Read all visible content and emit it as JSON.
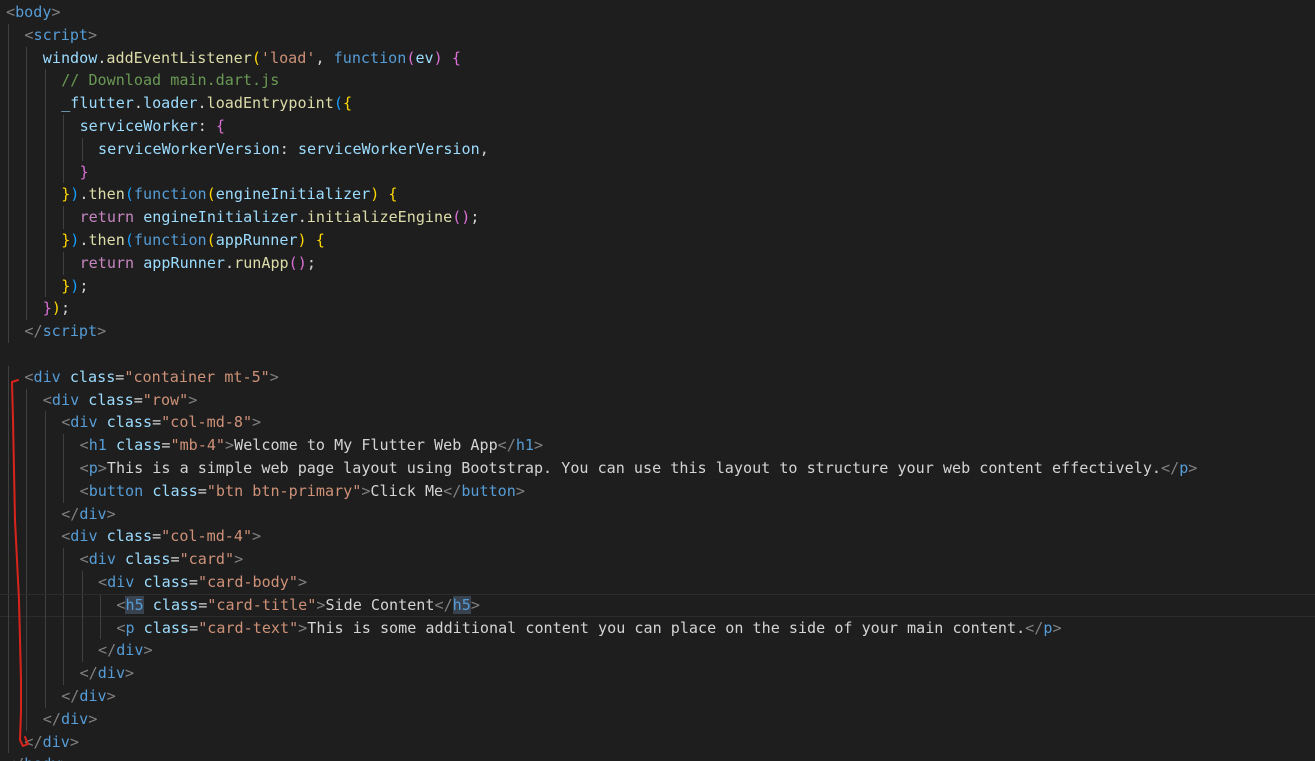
{
  "editor": {
    "theme_colors": {
      "background": "#1e1e1e",
      "tag": "#569cd6",
      "bracket": "#808080",
      "attribute": "#9cdcfe",
      "string": "#ce9178",
      "text": "#d4d4d4",
      "keyword": "#569cd6",
      "control_keyword": "#c586c0",
      "function": "#dcdcaa",
      "variable": "#9cdcfe",
      "comment": "#6a9955",
      "bracket_level_1": "#ffd700",
      "bracket_level_2": "#da70d6",
      "bracket_level_3": "#179fff",
      "annotation_stroke": "#d9241c"
    },
    "lines": [
      {
        "indent": 0,
        "tokens": [
          {
            "t": "<",
            "c": "t-bracket"
          },
          {
            "t": "body",
            "c": "t-tag"
          },
          {
            "t": ">",
            "c": "t-bracket"
          }
        ]
      },
      {
        "indent": 1,
        "tokens": [
          {
            "t": "<",
            "c": "t-bracket"
          },
          {
            "t": "script",
            "c": "t-tag"
          },
          {
            "t": ">",
            "c": "t-bracket"
          }
        ]
      },
      {
        "indent": 2,
        "tokens": [
          {
            "t": "window",
            "c": "t-var"
          },
          {
            "t": ".",
            "c": "t-text"
          },
          {
            "t": "addEventListener",
            "c": "t-fn"
          },
          {
            "t": "(",
            "c": "t-p1"
          },
          {
            "t": "'load'",
            "c": "t-str"
          },
          {
            "t": ", ",
            "c": "t-text"
          },
          {
            "t": "function",
            "c": "t-kw"
          },
          {
            "t": "(",
            "c": "t-p2"
          },
          {
            "t": "ev",
            "c": "t-var"
          },
          {
            "t": ")",
            "c": "t-p2"
          },
          {
            "t": " ",
            "c": "t-text"
          },
          {
            "t": "{",
            "c": "t-p2"
          }
        ]
      },
      {
        "indent": 3,
        "tokens": [
          {
            "t": "// Download main.dart.js",
            "c": "t-cmt"
          }
        ]
      },
      {
        "indent": 3,
        "tokens": [
          {
            "t": "_flutter",
            "c": "t-var"
          },
          {
            "t": ".",
            "c": "t-text"
          },
          {
            "t": "loader",
            "c": "t-var"
          },
          {
            "t": ".",
            "c": "t-text"
          },
          {
            "t": "loadEntrypoint",
            "c": "t-fn"
          },
          {
            "t": "(",
            "c": "t-p3"
          },
          {
            "t": "{",
            "c": "t-p1"
          }
        ]
      },
      {
        "indent": 4,
        "tokens": [
          {
            "t": "serviceWorker",
            "c": "t-var"
          },
          {
            "t": ": ",
            "c": "t-text"
          },
          {
            "t": "{",
            "c": "t-p2"
          }
        ]
      },
      {
        "indent": 5,
        "tokens": [
          {
            "t": "serviceWorkerVersion",
            "c": "t-var"
          },
          {
            "t": ": ",
            "c": "t-text"
          },
          {
            "t": "serviceWorkerVersion",
            "c": "t-var"
          },
          {
            "t": ",",
            "c": "t-text"
          }
        ]
      },
      {
        "indent": 4,
        "tokens": [
          {
            "t": "}",
            "c": "t-p2"
          }
        ]
      },
      {
        "indent": 3,
        "tokens": [
          {
            "t": "}",
            "c": "t-p1"
          },
          {
            "t": ")",
            "c": "t-p3"
          },
          {
            "t": ".",
            "c": "t-text"
          },
          {
            "t": "then",
            "c": "t-fn"
          },
          {
            "t": "(",
            "c": "t-p3"
          },
          {
            "t": "function",
            "c": "t-kw"
          },
          {
            "t": "(",
            "c": "t-p1"
          },
          {
            "t": "engineInitializer",
            "c": "t-var"
          },
          {
            "t": ")",
            "c": "t-p1"
          },
          {
            "t": " ",
            "c": "t-text"
          },
          {
            "t": "{",
            "c": "t-p1"
          }
        ]
      },
      {
        "indent": 4,
        "tokens": [
          {
            "t": "return",
            "c": "t-ctrl"
          },
          {
            "t": " ",
            "c": "t-text"
          },
          {
            "t": "engineInitializer",
            "c": "t-var"
          },
          {
            "t": ".",
            "c": "t-text"
          },
          {
            "t": "initializeEngine",
            "c": "t-fn"
          },
          {
            "t": "()",
            "c": "t-p2"
          },
          {
            "t": ";",
            "c": "t-text"
          }
        ]
      },
      {
        "indent": 3,
        "tokens": [
          {
            "t": "}",
            "c": "t-p1"
          },
          {
            "t": ")",
            "c": "t-p3"
          },
          {
            "t": ".",
            "c": "t-text"
          },
          {
            "t": "then",
            "c": "t-fn"
          },
          {
            "t": "(",
            "c": "t-p3"
          },
          {
            "t": "function",
            "c": "t-kw"
          },
          {
            "t": "(",
            "c": "t-p1"
          },
          {
            "t": "appRunner",
            "c": "t-var"
          },
          {
            "t": ")",
            "c": "t-p1"
          },
          {
            "t": " ",
            "c": "t-text"
          },
          {
            "t": "{",
            "c": "t-p1"
          }
        ]
      },
      {
        "indent": 4,
        "tokens": [
          {
            "t": "return",
            "c": "t-ctrl"
          },
          {
            "t": " ",
            "c": "t-text"
          },
          {
            "t": "appRunner",
            "c": "t-var"
          },
          {
            "t": ".",
            "c": "t-text"
          },
          {
            "t": "runApp",
            "c": "t-fn"
          },
          {
            "t": "()",
            "c": "t-p2"
          },
          {
            "t": ";",
            "c": "t-text"
          }
        ]
      },
      {
        "indent": 3,
        "tokens": [
          {
            "t": "}",
            "c": "t-p1"
          },
          {
            "t": ")",
            "c": "t-p3"
          },
          {
            "t": ";",
            "c": "t-text"
          }
        ]
      },
      {
        "indent": 2,
        "tokens": [
          {
            "t": "}",
            "c": "t-p2"
          },
          {
            "t": ")",
            "c": "t-p1"
          },
          {
            "t": ";",
            "c": "t-text"
          }
        ]
      },
      {
        "indent": 1,
        "tokens": [
          {
            "t": "</",
            "c": "t-bracket"
          },
          {
            "t": "script",
            "c": "t-tag"
          },
          {
            "t": ">",
            "c": "t-bracket"
          }
        ]
      },
      {
        "indent": 0,
        "tokens": []
      },
      {
        "indent": 1,
        "tokens": [
          {
            "t": "<",
            "c": "t-bracket"
          },
          {
            "t": "div",
            "c": "t-tag"
          },
          {
            "t": " ",
            "c": "t-text"
          },
          {
            "t": "class",
            "c": "t-attr"
          },
          {
            "t": "=",
            "c": "t-text"
          },
          {
            "t": "\"container mt-5\"",
            "c": "t-str"
          },
          {
            "t": ">",
            "c": "t-bracket"
          }
        ]
      },
      {
        "indent": 2,
        "tokens": [
          {
            "t": "<",
            "c": "t-bracket"
          },
          {
            "t": "div",
            "c": "t-tag"
          },
          {
            "t": " ",
            "c": "t-text"
          },
          {
            "t": "class",
            "c": "t-attr"
          },
          {
            "t": "=",
            "c": "t-text"
          },
          {
            "t": "\"row\"",
            "c": "t-str"
          },
          {
            "t": ">",
            "c": "t-bracket"
          }
        ]
      },
      {
        "indent": 3,
        "tokens": [
          {
            "t": "<",
            "c": "t-bracket"
          },
          {
            "t": "div",
            "c": "t-tag"
          },
          {
            "t": " ",
            "c": "t-text"
          },
          {
            "t": "class",
            "c": "t-attr"
          },
          {
            "t": "=",
            "c": "t-text"
          },
          {
            "t": "\"col-md-8\"",
            "c": "t-str"
          },
          {
            "t": ">",
            "c": "t-bracket"
          }
        ]
      },
      {
        "indent": 4,
        "tokens": [
          {
            "t": "<",
            "c": "t-bracket"
          },
          {
            "t": "h1",
            "c": "t-tag"
          },
          {
            "t": " ",
            "c": "t-text"
          },
          {
            "t": "class",
            "c": "t-attr"
          },
          {
            "t": "=",
            "c": "t-text"
          },
          {
            "t": "\"mb-4\"",
            "c": "t-str"
          },
          {
            "t": ">",
            "c": "t-bracket"
          },
          {
            "t": "Welcome to My Flutter Web App",
            "c": "t-text"
          },
          {
            "t": "</",
            "c": "t-bracket"
          },
          {
            "t": "h1",
            "c": "t-tag"
          },
          {
            "t": ">",
            "c": "t-bracket"
          }
        ]
      },
      {
        "indent": 4,
        "tokens": [
          {
            "t": "<",
            "c": "t-bracket"
          },
          {
            "t": "p",
            "c": "t-tag"
          },
          {
            "t": ">",
            "c": "t-bracket"
          },
          {
            "t": "This is a simple web page layout using Bootstrap. You can use this layout to structure your web content effectively.",
            "c": "t-text"
          },
          {
            "t": "</",
            "c": "t-bracket"
          },
          {
            "t": "p",
            "c": "t-tag"
          },
          {
            "t": ">",
            "c": "t-bracket"
          }
        ]
      },
      {
        "indent": 4,
        "tokens": [
          {
            "t": "<",
            "c": "t-bracket"
          },
          {
            "t": "button",
            "c": "t-tag"
          },
          {
            "t": " ",
            "c": "t-text"
          },
          {
            "t": "class",
            "c": "t-attr"
          },
          {
            "t": "=",
            "c": "t-text"
          },
          {
            "t": "\"btn btn-primary\"",
            "c": "t-str"
          },
          {
            "t": ">",
            "c": "t-bracket"
          },
          {
            "t": "Click Me",
            "c": "t-text"
          },
          {
            "t": "</",
            "c": "t-bracket"
          },
          {
            "t": "button",
            "c": "t-tag"
          },
          {
            "t": ">",
            "c": "t-bracket"
          }
        ]
      },
      {
        "indent": 3,
        "tokens": [
          {
            "t": "</",
            "c": "t-bracket"
          },
          {
            "t": "div",
            "c": "t-tag"
          },
          {
            "t": ">",
            "c": "t-bracket"
          }
        ]
      },
      {
        "indent": 3,
        "tokens": [
          {
            "t": "<",
            "c": "t-bracket"
          },
          {
            "t": "div",
            "c": "t-tag"
          },
          {
            "t": " ",
            "c": "t-text"
          },
          {
            "t": "class",
            "c": "t-attr"
          },
          {
            "t": "=",
            "c": "t-text"
          },
          {
            "t": "\"col-md-4\"",
            "c": "t-str"
          },
          {
            "t": ">",
            "c": "t-bracket"
          }
        ]
      },
      {
        "indent": 4,
        "tokens": [
          {
            "t": "<",
            "c": "t-bracket"
          },
          {
            "t": "div",
            "c": "t-tag"
          },
          {
            "t": " ",
            "c": "t-text"
          },
          {
            "t": "class",
            "c": "t-attr"
          },
          {
            "t": "=",
            "c": "t-text"
          },
          {
            "t": "\"card\"",
            "c": "t-str"
          },
          {
            "t": ">",
            "c": "t-bracket"
          }
        ]
      },
      {
        "indent": 5,
        "tokens": [
          {
            "t": "<",
            "c": "t-bracket"
          },
          {
            "t": "div",
            "c": "t-tag"
          },
          {
            "t": " ",
            "c": "t-text"
          },
          {
            "t": "class",
            "c": "t-attr"
          },
          {
            "t": "=",
            "c": "t-text"
          },
          {
            "t": "\"card-body\"",
            "c": "t-str"
          },
          {
            "t": ">",
            "c": "t-bracket"
          }
        ]
      },
      {
        "indent": 6,
        "current": true,
        "tokens": [
          {
            "t": "<",
            "c": "t-bracket"
          },
          {
            "t": "h5",
            "c": "t-tag t-hl"
          },
          {
            "t": " ",
            "c": "t-text"
          },
          {
            "t": "class",
            "c": "t-attr"
          },
          {
            "t": "=",
            "c": "t-text"
          },
          {
            "t": "\"card-title\"",
            "c": "t-str"
          },
          {
            "t": ">",
            "c": "t-bracket"
          },
          {
            "t": "Side Content",
            "c": "t-text"
          },
          {
            "t": "</",
            "c": "t-bracket"
          },
          {
            "t": "h5",
            "c": "t-tag t-hl"
          },
          {
            "t": ">",
            "c": "t-bracket"
          }
        ]
      },
      {
        "indent": 6,
        "tokens": [
          {
            "t": "<",
            "c": "t-bracket"
          },
          {
            "t": "p",
            "c": "t-tag"
          },
          {
            "t": " ",
            "c": "t-text"
          },
          {
            "t": "class",
            "c": "t-attr"
          },
          {
            "t": "=",
            "c": "t-text"
          },
          {
            "t": "\"card-text\"",
            "c": "t-str"
          },
          {
            "t": ">",
            "c": "t-bracket"
          },
          {
            "t": "This is some additional content you can place on the side of your main content.",
            "c": "t-text"
          },
          {
            "t": "</",
            "c": "t-bracket"
          },
          {
            "t": "p",
            "c": "t-tag"
          },
          {
            "t": ">",
            "c": "t-bracket"
          }
        ]
      },
      {
        "indent": 5,
        "tokens": [
          {
            "t": "</",
            "c": "t-bracket"
          },
          {
            "t": "div",
            "c": "t-tag"
          },
          {
            "t": ">",
            "c": "t-bracket"
          }
        ]
      },
      {
        "indent": 4,
        "tokens": [
          {
            "t": "</",
            "c": "t-bracket"
          },
          {
            "t": "div",
            "c": "t-tag"
          },
          {
            "t": ">",
            "c": "t-bracket"
          }
        ]
      },
      {
        "indent": 3,
        "tokens": [
          {
            "t": "</",
            "c": "t-bracket"
          },
          {
            "t": "div",
            "c": "t-tag"
          },
          {
            "t": ">",
            "c": "t-bracket"
          }
        ]
      },
      {
        "indent": 2,
        "tokens": [
          {
            "t": "</",
            "c": "t-bracket"
          },
          {
            "t": "div",
            "c": "t-tag"
          },
          {
            "t": ">",
            "c": "t-bracket"
          }
        ]
      },
      {
        "indent": 1,
        "tokens": [
          {
            "t": "</",
            "c": "t-bracket"
          },
          {
            "t": "div",
            "c": "t-tag"
          },
          {
            "t": ">",
            "c": "t-bracket"
          }
        ]
      },
      {
        "indent": 0,
        "tokens": [
          {
            "t": "</",
            "c": "t-bracket"
          },
          {
            "t": "body",
            "c": "t-tag"
          },
          {
            "t": ">",
            "c": "t-bracket"
          }
        ]
      }
    ]
  }
}
